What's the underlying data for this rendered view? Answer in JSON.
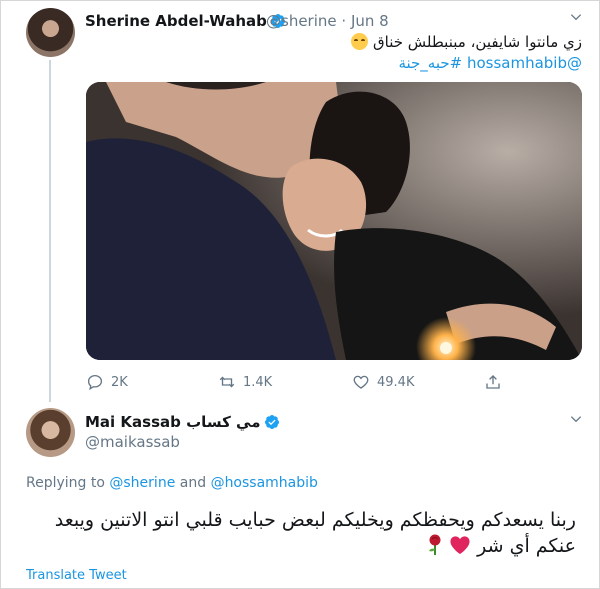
{
  "tweet": {
    "author_name": "Sherine Abdel-Wahab",
    "handle": "@sherine",
    "separator": "·",
    "date": "Jun 8",
    "text_line1": "زي مانتوا شايفين، مبنبطلش خناق",
    "text_line2": "@hossamhabib #حبه_جنة",
    "stats": {
      "replies": "2K",
      "retweets": "1.4K",
      "likes": "49.4K"
    }
  },
  "reply": {
    "author_name": "Mai Kassab مي كساب",
    "handle": "@maikassab",
    "replying_prefix": "Replying to",
    "replying_user1": "@sherine",
    "replying_and": "and",
    "replying_user2": "@hossamhabib",
    "text": "ربنا يسعدكم ويحفظكم ويخليكم لبعض حبايب قلبي انتو الاتنين ويبعد عنكم أي شر",
    "translate_label": "Translate Tweet"
  },
  "colors": {
    "link": "#1b95e0",
    "muted": "#657786",
    "text": "#14171a",
    "verified": "#1da1f2",
    "heart": "#e0245e"
  },
  "icons": {
    "verified": "verified-badge-icon",
    "chevron": "chevron-down-icon",
    "reply": "reply-icon",
    "retweet": "retweet-icon",
    "like": "heart-outline-icon",
    "share": "share-icon"
  }
}
